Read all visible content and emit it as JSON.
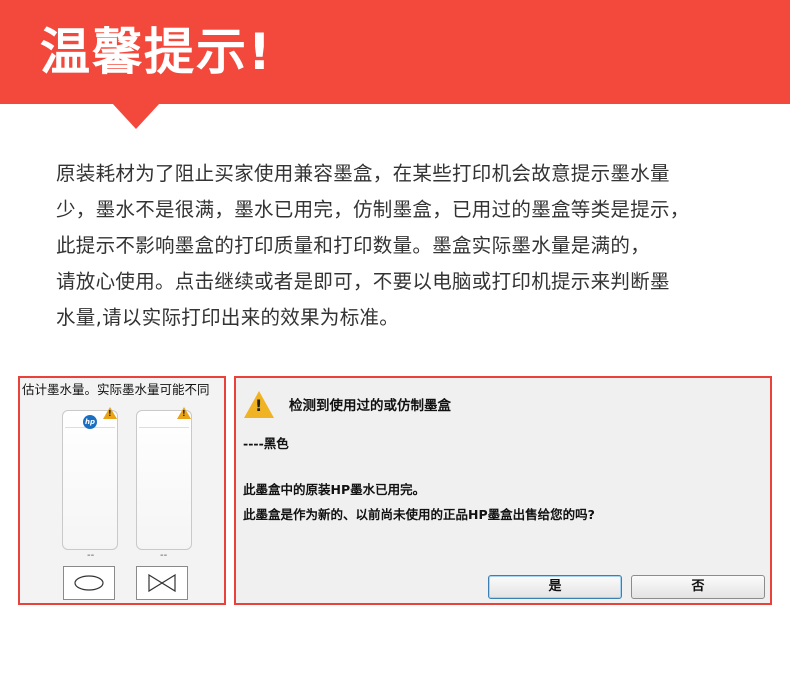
{
  "banner": {
    "title": "温馨提示!"
  },
  "body_lines": [
    "原装耗材为了阻止买家使用兼容墨盒，在某些打印机会故意提示墨水量",
    "少，墨水不是很满，墨水已用完，仿制墨盒，已用过的墨盒等类是提示，",
    "此提示不影响墨盒的打印质量和打印数量。墨盒实际墨水量是满的，",
    "请放心使用。点击继续或者是即可，不要以电脑或打印机提示来判断墨",
    "水量,请以实际打印出来的效果为标准。"
  ],
  "ink_panel": {
    "header": "估计墨水量。实际墨水量可能不同",
    "cartridge_labels": [
      "--",
      "--"
    ],
    "icons": [
      "hp-logo",
      "warning-icon",
      "circle-icon",
      "bowtie-icon"
    ]
  },
  "dialog": {
    "title": "检测到使用过的或仿制墨盒",
    "color_line": "----黑色",
    "message1": "此墨盒中的原装HP墨水已用完。",
    "message2": "此墨盒是作为新的、以前尚未使用的正品HP墨盒出售给您的吗?",
    "yes_label": "是",
    "no_label": "否"
  },
  "colors": {
    "accent": "#f2493c",
    "warning": "#f0b323",
    "hp_blue": "#1a6fc4"
  }
}
